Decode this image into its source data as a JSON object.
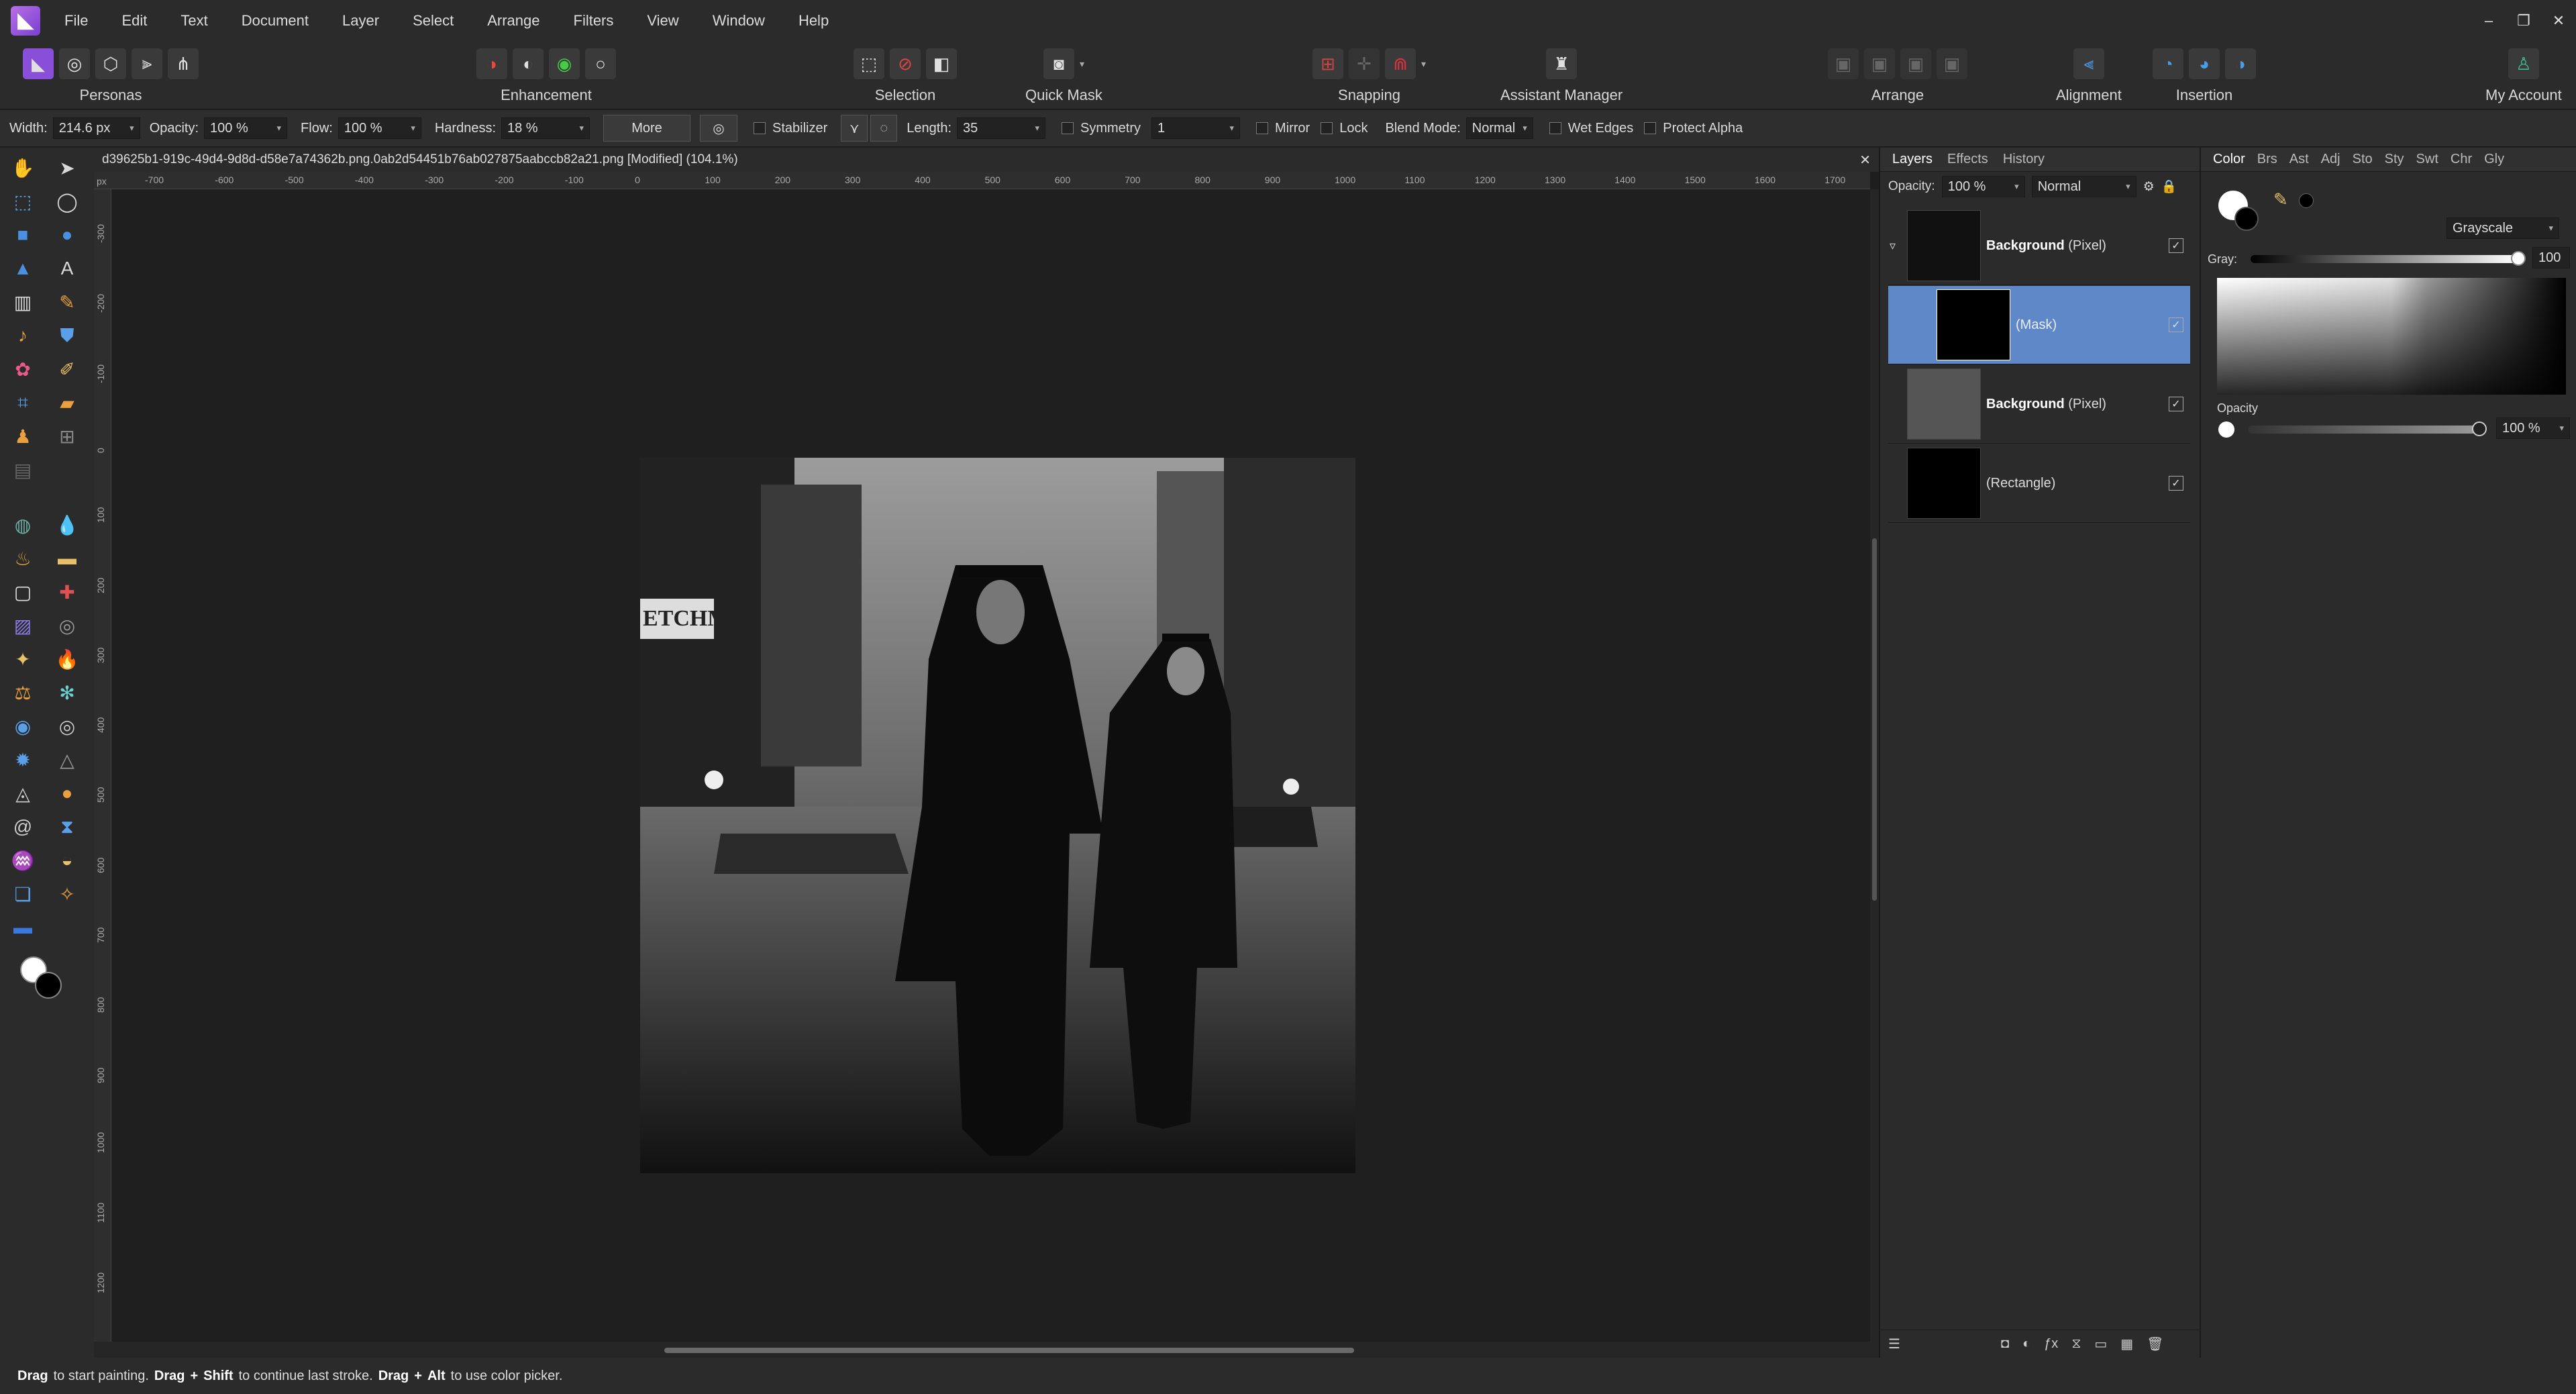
{
  "menubar": {
    "items": [
      "File",
      "Edit",
      "Text",
      "Document",
      "Layer",
      "Select",
      "Arrange",
      "Filters",
      "View",
      "Window",
      "Help"
    ]
  },
  "toolbar": {
    "personas_label": "Personas",
    "enhancement_label": "Enhancement",
    "selection_label": "Selection",
    "quickmask_label": "Quick Mask",
    "snapping_label": "Snapping",
    "assistant_label": "Assistant Manager",
    "arrange_label": "Arrange",
    "alignment_label": "Alignment",
    "insertion_label": "Insertion",
    "account_label": "My Account"
  },
  "context": {
    "width_label": "Width:",
    "width_value": "214.6 px",
    "opacity_label": "Opacity:",
    "opacity_value": "100 %",
    "flow_label": "Flow:",
    "flow_value": "100 %",
    "hardness_label": "Hardness:",
    "hardness_value": "18 %",
    "more_label": "More",
    "stabilizer_label": "Stabilizer",
    "length_label": "Length:",
    "length_value": "35",
    "symmetry_label": "Symmetry",
    "symmetry_value": "1",
    "mirror_label": "Mirror",
    "lock_label": "Lock",
    "blend_label": "Blend Mode:",
    "blend_value": "Normal",
    "wet_label": "Wet Edges",
    "protect_label": "Protect Alpha"
  },
  "document": {
    "title": "d39625b1-919c-49d4-9d8d-d58e7a74362b.png.0ab2d54451b76ab027875aabccb82a21.png [Modified] (104.1%)"
  },
  "ruler": {
    "unit": "px",
    "h_ticks": [
      "-700",
      "-600",
      "-500",
      "-400",
      "-300",
      "-200",
      "-100",
      "0",
      "100",
      "200",
      "300",
      "400",
      "500",
      "600",
      "700",
      "800",
      "900",
      "1000",
      "1100",
      "1200",
      "1300",
      "1400",
      "1500",
      "1600",
      "1700"
    ],
    "v_ticks": [
      "-300",
      "-200",
      "-100",
      "0",
      "100",
      "200",
      "300",
      "400",
      "500",
      "600",
      "700",
      "800",
      "900",
      "1000",
      "1100",
      "1200"
    ]
  },
  "image": {
    "sign_text": "ETCHMIE"
  },
  "layers_panel": {
    "tabs": [
      "Layers",
      "Effects",
      "History"
    ],
    "opacity_label": "Opacity:",
    "opacity_value": "100 %",
    "blend_value": "Normal",
    "layers": [
      {
        "name": "Background",
        "kind": "(Pixel)"
      },
      {
        "name": "",
        "kind": "(Mask)"
      },
      {
        "name": "Background",
        "kind": "(Pixel)"
      },
      {
        "name": "",
        "kind": "(Rectangle)"
      }
    ]
  },
  "color_panel": {
    "tabs": [
      "Color",
      "Brs",
      "Ast",
      "Adj",
      "Sto",
      "Sty",
      "Swt",
      "Chr",
      "Gly"
    ],
    "mode": "Grayscale",
    "gray_label": "Gray:",
    "gray_value": "100",
    "opacity_label": "Opacity",
    "opacity_value": "100 %"
  },
  "status": {
    "p1": "Drag",
    "p2": " to start painting. ",
    "p3": "Drag",
    "p4": "+",
    "p5": "Shift",
    "p6": " to continue last stroke. ",
    "p7": "Drag",
    "p8": "+",
    "p9": "Alt",
    "p10": " to use color picker."
  }
}
